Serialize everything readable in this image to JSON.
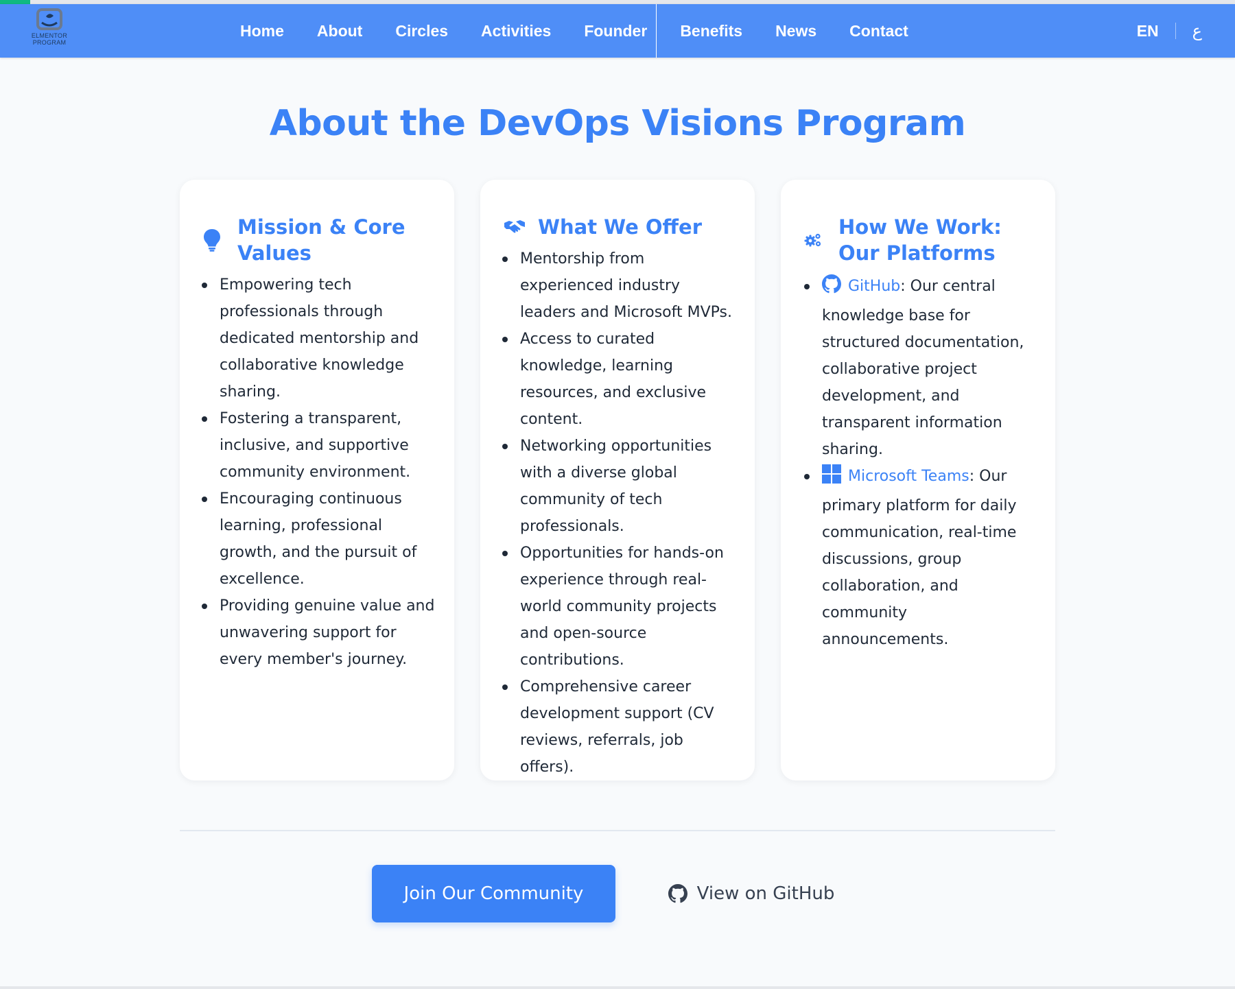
{
  "nav": {
    "logo_text_line1": "ELMENTOR",
    "logo_text_line2": "PROGRAM",
    "links": [
      "Home",
      "About",
      "Circles",
      "Activities",
      "Founder",
      "Benefits",
      "News",
      "Contact"
    ],
    "lang_en": "EN",
    "lang_ar": "ع",
    "accent": "#4f8ef7"
  },
  "page": {
    "title": "About the DevOps Visions Program",
    "title_color": "#3b82f6"
  },
  "cards": [
    {
      "icon": "lightbulb-icon",
      "title": "Mission & Core Values",
      "items": [
        "Empowering tech professionals through dedicated mentorship and collaborative knowledge sharing.",
        "Fostering a transparent, inclusive, and supportive community environment.",
        "Encouraging continuous learning, professional growth, and the pursuit of excellence.",
        "Providing genuine value and unwavering support for every member's journey."
      ]
    },
    {
      "icon": "handshake-icon",
      "title": "What We Offer",
      "items": [
        "Mentorship from experienced industry leaders and Microsoft MVPs.",
        "Access to curated knowledge, learning resources, and exclusive content.",
        "Networking opportunities with a diverse global community of tech professionals.",
        "Opportunities for hands-on experience through real-world community projects and open-source contributions.",
        "Comprehensive career development support (CV reviews, referrals, job offers)."
      ]
    },
    {
      "icon": "gears-icon",
      "title": "How We Work: Our Platforms",
      "platforms": [
        {
          "icon": "github-icon",
          "name": "GitHub",
          "description": ": Our central knowledge base for structured documentation, collaborative project development, and transparent information sharing."
        },
        {
          "icon": "windows-icon",
          "name": "Microsoft Teams",
          "description": ": Our primary platform for daily communication, real-time discussions, group collaboration, and community announcements."
        }
      ]
    }
  ],
  "cta": {
    "primary_label": "Join Our Community",
    "secondary_label": "View on GitHub",
    "secondary_icon": "github-icon"
  }
}
